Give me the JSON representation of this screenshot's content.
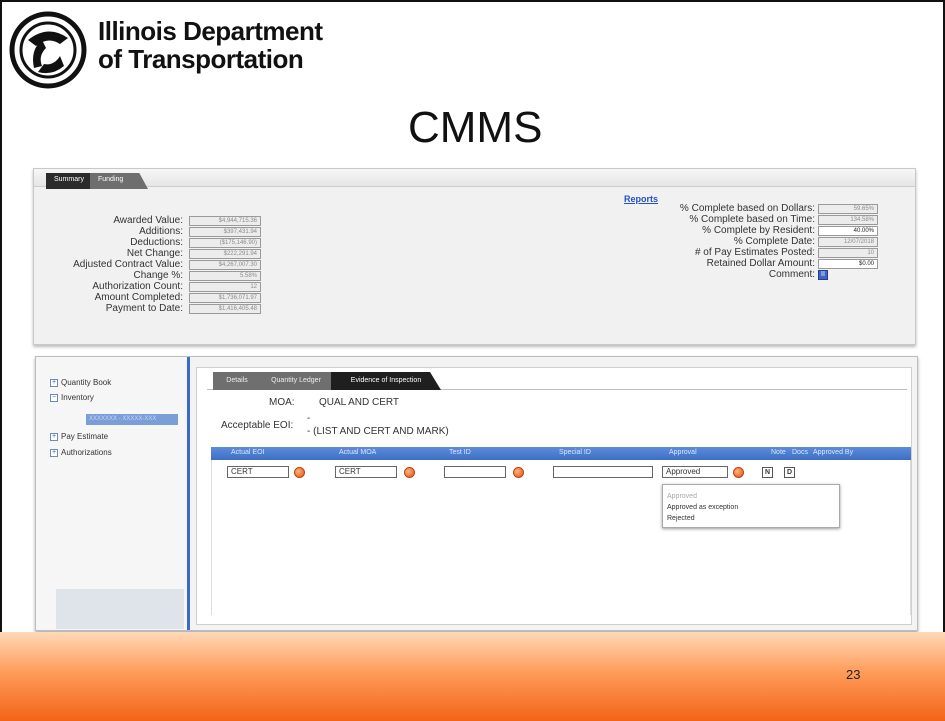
{
  "header": {
    "org_line1": "Illinois Department",
    "org_line2": "of Transportation",
    "title": "CMMS",
    "page_number": "23"
  },
  "summary": {
    "tabs": [
      "Summary",
      "Funding"
    ],
    "reports_link": "Reports",
    "left_fields": [
      {
        "label": "Awarded Value:",
        "value": "$4,944,715.36"
      },
      {
        "label": "Additions:",
        "value": "$397,431.94"
      },
      {
        "label": "Deductions:",
        "value": "($175,146.90)"
      },
      {
        "label": "Net Change:",
        "value": "$222,291.94"
      },
      {
        "label": "Adjusted Contract Value:",
        "value": "$4,267,007.30"
      },
      {
        "label": "Change %:",
        "value": "5.58%"
      },
      {
        "label": "Authorization Count:",
        "value": "12"
      },
      {
        "label": "Amount Completed:",
        "value": "$1,736,071.97"
      },
      {
        "label": "Payment to Date:",
        "value": "$1,416,405.48"
      }
    ],
    "right_fields": [
      {
        "label": "% Complete based on Dollars:",
        "value": "59.65%"
      },
      {
        "label": "% Complete based on Time:",
        "value": "134.58%"
      },
      {
        "label": "% Complete by Resident:",
        "value": "40.00%"
      },
      {
        "label": "% Complete Date:",
        "value": "12/07/2018"
      },
      {
        "label": "# of Pay Estimates Posted:",
        "value": "10"
      },
      {
        "label": "Retained Dollar Amount:",
        "value": "$0.00"
      },
      {
        "label": "Comment:",
        "value": "II"
      }
    ]
  },
  "tree": {
    "items": [
      "Quantity Book",
      "Inventory",
      "Pay Estimate",
      "Authorizations"
    ],
    "selected_item": "XXXXXXX - XXXXX-XXX"
  },
  "detail": {
    "tabs": [
      "Details",
      "Quantity Ledger",
      "Evidence of Inspection"
    ],
    "moa_label": "MOA:",
    "moa_value": "QUAL AND CERT",
    "eoi_label": "Acceptable EOI:",
    "eoi_value1": "-",
    "eoi_value2": "- (LIST AND CERT AND MARK)",
    "columns": [
      "Actual EOI",
      "Actual MOA",
      "Test ID",
      "Special ID",
      "Approval",
      "Note",
      "Docs",
      "Approved By"
    ],
    "row": {
      "actual_eoi": "CERT",
      "actual_moa": "CERT",
      "test_id": "",
      "special_id": "",
      "approval": "Approved",
      "note_btn": "N",
      "docs_btn": "D"
    },
    "approval_options": [
      "Approved",
      "Approved as exception",
      "Rejected"
    ]
  }
}
